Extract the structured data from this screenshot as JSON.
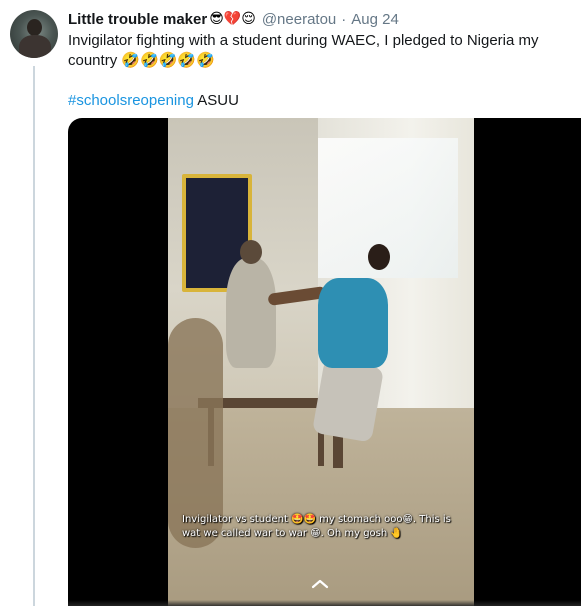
{
  "tweet": {
    "display_name": "Little trouble maker",
    "name_emojis": "😎💔😌",
    "handle": "@neeratou",
    "separator": "·",
    "date": "Aug 24",
    "text": "Invigilator fighting with a student during WAEC, I pledged to Nigeria my country 🤣🤣🤣🤣🤣",
    "hashtag": "#schoolsreopening",
    "trailing_text": " ASUU"
  },
  "media": {
    "caption": "Invigilator vs student 🤩🤩 my stomach ooo😁. This is wat we called war to war 😁. Oh my gosh 🤚"
  },
  "colors": {
    "link": "#1b95e0",
    "secondary_text": "#657786",
    "primary_text": "#14171a"
  }
}
